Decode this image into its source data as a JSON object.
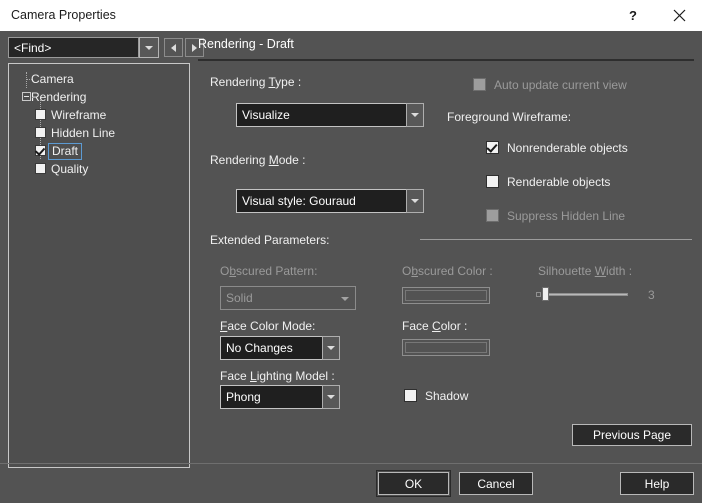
{
  "window": {
    "title": "Camera Properties",
    "help_icon": "question-mark-icon",
    "close_icon": "close-x-icon"
  },
  "toolbar": {
    "find_value": "<Find>",
    "find_dropdown_icon": "chevron-down-icon",
    "prev_icon": "triangle-left-icon",
    "next_icon": "triangle-right-icon"
  },
  "tree": {
    "items": [
      {
        "label": "Camera",
        "level": 0,
        "checkbox": false,
        "expander": null,
        "checked": false,
        "selected": false
      },
      {
        "label": "Rendering",
        "level": 0,
        "checkbox": false,
        "expander": "minus",
        "checked": false,
        "selected": false
      },
      {
        "label": "Wireframe",
        "level": 1,
        "checkbox": true,
        "expander": null,
        "checked": false,
        "selected": false
      },
      {
        "label": "Hidden Line",
        "level": 1,
        "checkbox": true,
        "expander": null,
        "checked": false,
        "selected": false
      },
      {
        "label": "Draft",
        "level": 1,
        "checkbox": true,
        "expander": null,
        "checked": true,
        "selected": true
      },
      {
        "label": "Quality",
        "level": 1,
        "checkbox": true,
        "expander": null,
        "checked": false,
        "selected": false
      }
    ]
  },
  "pane": {
    "header": "Rendering - Draft",
    "rendering_type_label": "Rendering Type :",
    "rendering_type_value": "Visualize",
    "rendering_mode_label": "Rendering Mode :",
    "rendering_mode_value": "Visual style: Gouraud",
    "extended_parameters_label": "Extended Parameters:",
    "auto_update_label": "Auto update current view",
    "foreground_wireframe_label": "Foreground Wireframe:",
    "nonrenderable_label": "Nonrenderable objects",
    "renderable_label": "Renderable objects",
    "suppress_hidden_line_label": "Suppress Hidden Line",
    "obscured_pattern_label": "Obscured Pattern:",
    "obscured_pattern_value": "Solid",
    "face_color_mode_label": "Face Color Mode:",
    "face_color_mode_value": "No Changes",
    "face_lighting_model_label": "Face Lighting Model :",
    "face_lighting_model_value": "Phong",
    "obscured_color_label": "Obscured Color :",
    "face_color_label": "Face Color :",
    "silhouette_width_label": "Silhouette Width :",
    "silhouette_width_value": "3",
    "shadow_label": "Shadow",
    "previous_page_label": "Previous  Page"
  },
  "footer": {
    "ok_label": "OK",
    "cancel_label": "Cancel",
    "help_label": "Help"
  },
  "colors": {
    "dialog_bg": "#535353",
    "titlebar_bg": "#ffffff",
    "field_bg": "#1f1f1f",
    "selection_outline": "#5c9ad2",
    "disabled_text": "#9a9a9a"
  }
}
